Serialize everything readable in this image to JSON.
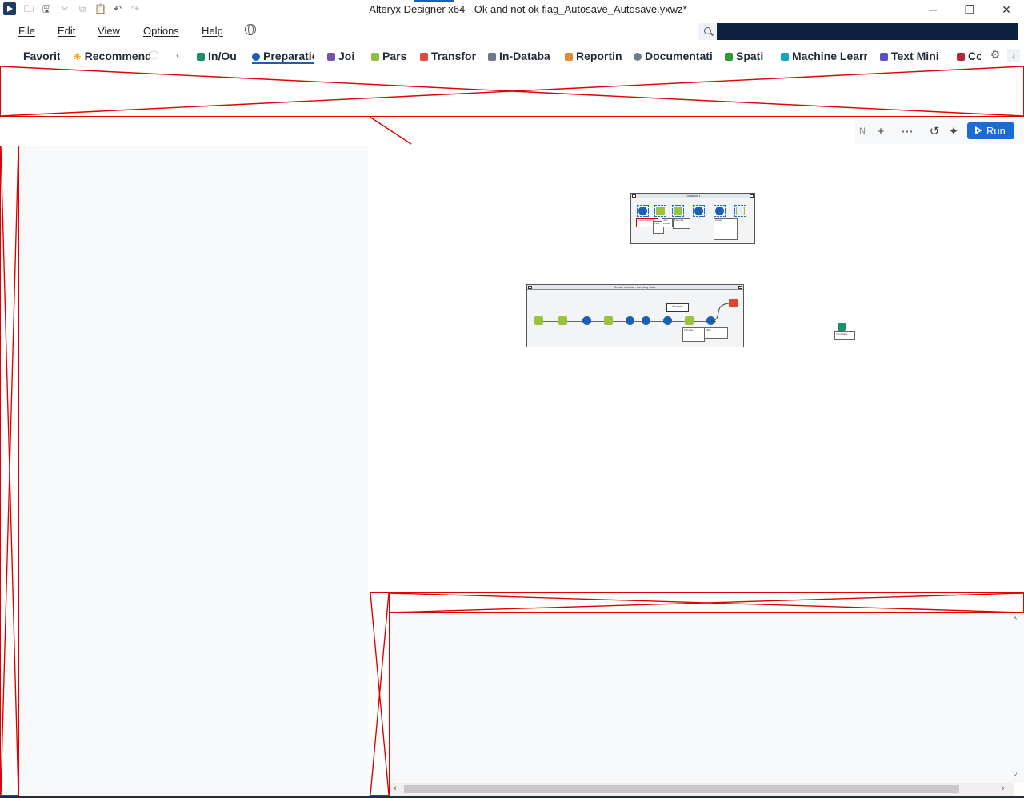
{
  "window": {
    "title": "Alteryx Designer x64 - Ok and not ok flag_Autosave_Autosave.yxwz*",
    "minimize_glyph": "─",
    "restore_glyph": "❐",
    "close_glyph": "✕"
  },
  "quick_access": {
    "open_glyph": "🗀",
    "save_glyph": "🖫",
    "cut_glyph": "✂",
    "copy_glyph": "⧉",
    "paste_glyph": "📋",
    "undo_glyph": "↶",
    "redo_glyph": "↷"
  },
  "menu": {
    "file": "File",
    "edit": "Edit",
    "view": "View",
    "options": "Options",
    "help": "Help"
  },
  "search": {
    "value": ""
  },
  "palette": {
    "prev_glyph": "‹",
    "next_glyph": "›",
    "favorites": "Favorit",
    "recommended": "Recommend",
    "tabs": [
      {
        "label": "In/Ou",
        "color": "#1a8f6a"
      },
      {
        "label": "Preparatio",
        "color": "#1a5fb4"
      },
      {
        "label": "Joi",
        "color": "#7b4fb0"
      },
      {
        "label": "Pars",
        "color": "#8fbf3f"
      },
      {
        "label": "Transfor",
        "color": "#e34a3a"
      },
      {
        "label": "In-Databa",
        "color": "#6a7a8c"
      },
      {
        "label": "Reportin",
        "color": "#e48a2e"
      },
      {
        "label": "Documentati",
        "color": "#6f7c8a"
      },
      {
        "label": "Spati",
        "color": "#2e9a3a"
      },
      {
        "label": "Machine Learr",
        "color": "#12a8b8"
      },
      {
        "label": "Text Mini",
        "color": "#5a4fc8"
      },
      {
        "label": "Co",
        "color": "#b2283a"
      }
    ]
  },
  "canvas_toolbar": {
    "cut_label": "N",
    "add_glyph": "+",
    "more_glyph": "⋯",
    "history_glyph": "↺",
    "wand_glyph": "✦",
    "run_label": "Run"
  },
  "workflow": {
    "container_1_title": "Container 1",
    "container_2_title": "Create Variants - Inventory Data",
    "browse_label": "Browse",
    "note_error": "Cannot read file",
    "note_1": "Filter:",
    "note_2": "Join Fields",
    "note_3": "Formula:",
    "note_4": "Output",
    "tool_label": "Input Data"
  },
  "scrollbars": {
    "left_glyph": "‹",
    "right_glyph": "›",
    "up_glyph": "˄",
    "down_glyph": "˅"
  },
  "colors": {
    "accent": "#1a6bd6",
    "placeholder_border": "#e00000",
    "search_bg": "#0e2240"
  }
}
